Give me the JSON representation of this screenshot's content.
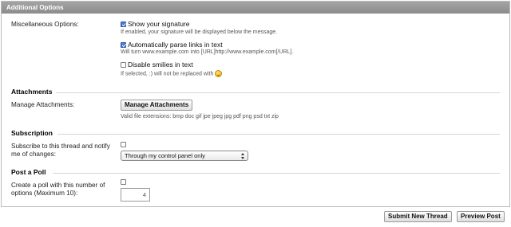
{
  "panel": {
    "title": "Additional Options"
  },
  "misc": {
    "label": "Miscellaneous Options:",
    "options": [
      {
        "label": "Show your signature",
        "checked": true,
        "hint": "If enabled, your signature will be displayed below the message."
      },
      {
        "label": "Automatically parse links in text",
        "checked": true,
        "hint": "Will turn www.example.com into [URL]http://www.example.com[/URL]."
      },
      {
        "label": "Disable smilies in text",
        "checked": false,
        "hint": "If selected, :) will not be replaced with"
      }
    ]
  },
  "attachments": {
    "section_title": "Attachments",
    "label": "Manage Attachments:",
    "button": "Manage Attachments",
    "hint": "Valid file extensions: bmp doc gif jpe jpeg jpg pdf png psd txt zip"
  },
  "subscription": {
    "section_title": "Subscription",
    "label_line1": "Subscribe to this thread and notify",
    "label_line2": "me of changes:",
    "checked": false,
    "select_value": "Through my control panel only"
  },
  "poll": {
    "section_title": "Post a Poll",
    "label_line1": "Create a poll with this number of",
    "label_line2": "options (Maximum 10):",
    "checked": false,
    "options_value": "4"
  },
  "actions": {
    "submit": "Submit New Thread",
    "preview": "Preview Post"
  },
  "icons": {
    "smiley": "smiley-icon"
  }
}
